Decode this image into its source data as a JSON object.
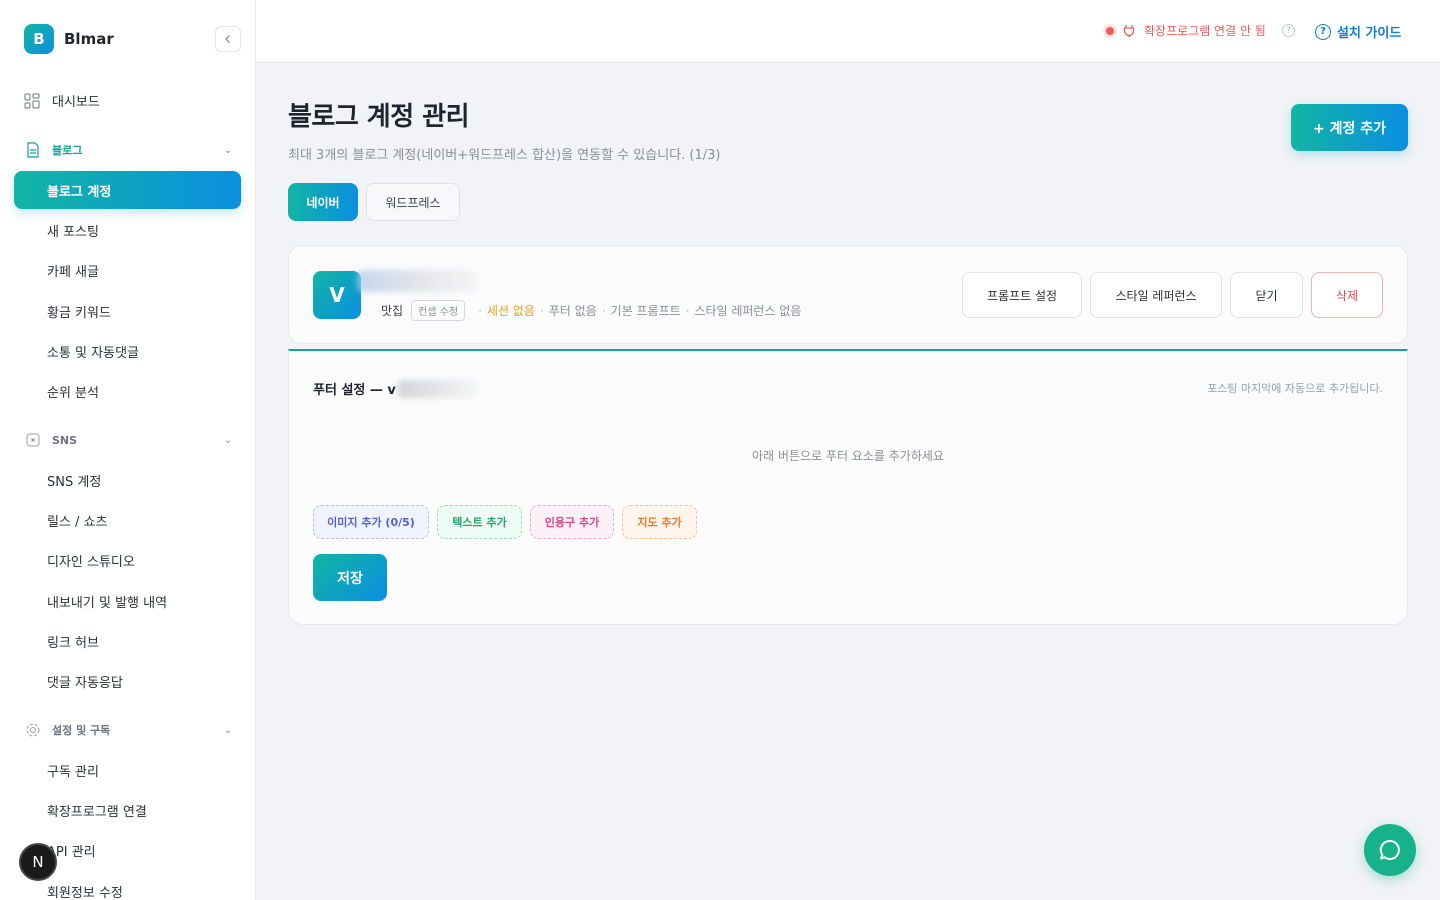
{
  "sidebar": {
    "brand": {
      "logo_letter": "B",
      "name": "Blmar"
    },
    "dashboard": "대시보드",
    "sections": {
      "blog": {
        "title": "블로그",
        "items": [
          "블로그 계정",
          "새 포스팅",
          "카페 새글",
          "황금 키워드",
          "소통 및 자동댓글",
          "순위 분석"
        ]
      },
      "sns": {
        "title": "SNS",
        "items": [
          "SNS 계정",
          "릴스 / 쇼츠",
          "디자인 스튜디오",
          "내보내기 및 발행 내역",
          "링크 허브",
          "댓글 자동응답"
        ]
      },
      "settings": {
        "title": "설정 및 구독",
        "items": [
          "구독 관리",
          "확장프로그램 연결",
          "API 관리",
          "회원정보 수정"
        ]
      }
    },
    "active_item": "블로그 계정",
    "bottom_badge": "N"
  },
  "topbar": {
    "extension_status": "확장프로그램 연결 안 됨",
    "help_icon": "?",
    "install_guide": "설치 가이드"
  },
  "page": {
    "title": "블로그 계정 관리",
    "subtitle": "최대 3개의 블로그 계정(네이버+워드프레스 합산)을 연동할 수 있습니다. (1/3)",
    "add_account_button": "+ 계정 추가",
    "tabs": [
      {
        "label": "네이버",
        "active": true
      },
      {
        "label": "워드프레스",
        "active": false
      }
    ]
  },
  "account": {
    "avatar_letter": "V",
    "category": "맛집",
    "concept_button": "컨셉 수정",
    "meta": [
      "세션 없음",
      "푸터 없음",
      "기본 프롬프트",
      "스타일 레퍼런스 없음"
    ],
    "buttons": {
      "prompt": "프롬프트 설정",
      "style": "스타일 레퍼런스",
      "close": "닫기",
      "delete": "삭제"
    }
  },
  "footer_settings": {
    "title_prefix": "푸터 설정 — v",
    "note": "포스팅 마지막에 자동으로 추가됩니다.",
    "empty_message": "아래 버튼으로 푸터 요소를 추가하세요",
    "chips": {
      "image": "이미지 추가 (0/5)",
      "text": "텍스트 추가",
      "quote": "인용구 추가",
      "map": "지도 추가"
    },
    "save_button": "저장"
  },
  "colors": {
    "accent_start": "#12b5a4",
    "accent_end": "#0a8fe0",
    "danger": "#e24b4b",
    "warning": "#e5a21c"
  }
}
